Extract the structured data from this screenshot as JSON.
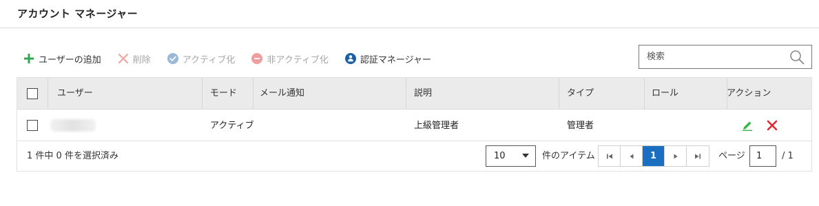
{
  "header": {
    "title": "アカウント マネージャー"
  },
  "toolbar": {
    "add_user": "ユーザーの追加",
    "delete": "削除",
    "activate": "アクティブ化",
    "deactivate": "非アクティブ化",
    "auth_manager": "認証マネージャー"
  },
  "search": {
    "placeholder": "検索"
  },
  "table": {
    "columns": [
      "ユーザー",
      "モード",
      "メール通知",
      "説明",
      "タイプ",
      "ロール",
      "アクション"
    ],
    "rows": [
      {
        "user": "",
        "mode": "アクティブ",
        "email_notification": "",
        "description": "上級管理者",
        "type": "管理者",
        "role": ""
      }
    ]
  },
  "footer": {
    "selection_status": "1 件中 0 件を選択済み",
    "page_size": "10",
    "items_label": "件のアイテム",
    "current_page_button": "1",
    "page_label": "ページ",
    "page_input": "1",
    "page_total": "/  1"
  },
  "colors": {
    "add_green": "#2fa84f",
    "disabled_gray": "#a6a6a6",
    "auth_blue": "#1b5fa8",
    "active_page_blue": "#1b6fc0",
    "edit_green": "#3bb54a",
    "delete_red": "#e0282e"
  }
}
